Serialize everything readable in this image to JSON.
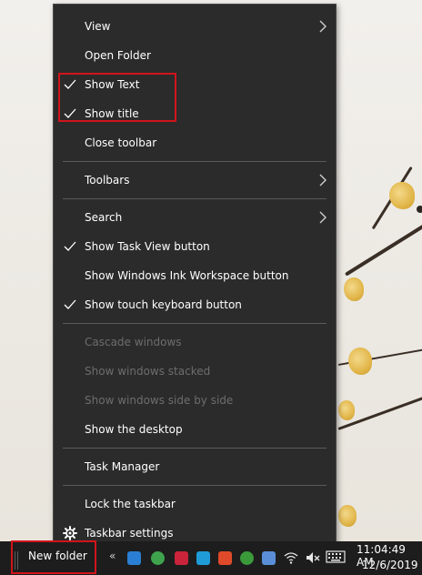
{
  "context_menu": {
    "items": [
      {
        "label": "View",
        "submenu": true,
        "checked": false,
        "disabled": false
      },
      {
        "label": "Open Folder",
        "submenu": false,
        "checked": false,
        "disabled": false
      },
      {
        "label": "Show Text",
        "submenu": false,
        "checked": true,
        "disabled": false
      },
      {
        "label": "Show title",
        "submenu": false,
        "checked": true,
        "disabled": false
      },
      {
        "label": "Close toolbar",
        "submenu": false,
        "checked": false,
        "disabled": false
      },
      {
        "label": "Toolbars",
        "submenu": true,
        "checked": false,
        "disabled": false
      },
      {
        "label": "Search",
        "submenu": true,
        "checked": false,
        "disabled": false
      },
      {
        "label": "Show Task View button",
        "submenu": false,
        "checked": true,
        "disabled": false
      },
      {
        "label": "Show Windows Ink Workspace button",
        "submenu": false,
        "checked": false,
        "disabled": false
      },
      {
        "label": "Show touch keyboard button",
        "submenu": false,
        "checked": true,
        "disabled": false
      },
      {
        "label": "Cascade windows",
        "submenu": false,
        "checked": false,
        "disabled": true
      },
      {
        "label": "Show windows stacked",
        "submenu": false,
        "checked": false,
        "disabled": true
      },
      {
        "label": "Show windows side by side",
        "submenu": false,
        "checked": false,
        "disabled": true
      },
      {
        "label": "Show the desktop",
        "submenu": false,
        "checked": false,
        "disabled": false
      },
      {
        "label": "Task Manager",
        "submenu": false,
        "checked": false,
        "disabled": false
      },
      {
        "label": "Lock the taskbar",
        "submenu": false,
        "checked": false,
        "disabled": false
      },
      {
        "label": "Taskbar settings",
        "submenu": false,
        "checked": false,
        "disabled": false,
        "icon": "gear-icon"
      }
    ]
  },
  "taskbar": {
    "toolbar_label": "New folder",
    "chevron_text": "«",
    "clock_time": "11:04:49 AM",
    "clock_date": "12/6/2019"
  },
  "colors": {
    "menu_bg": "#2b2b2b",
    "separator": "#5a5a5a",
    "highlight_box": "#d0141b",
    "taskbar_bg": "#1d1d1d",
    "disabled_text": "#6d6d6d"
  }
}
